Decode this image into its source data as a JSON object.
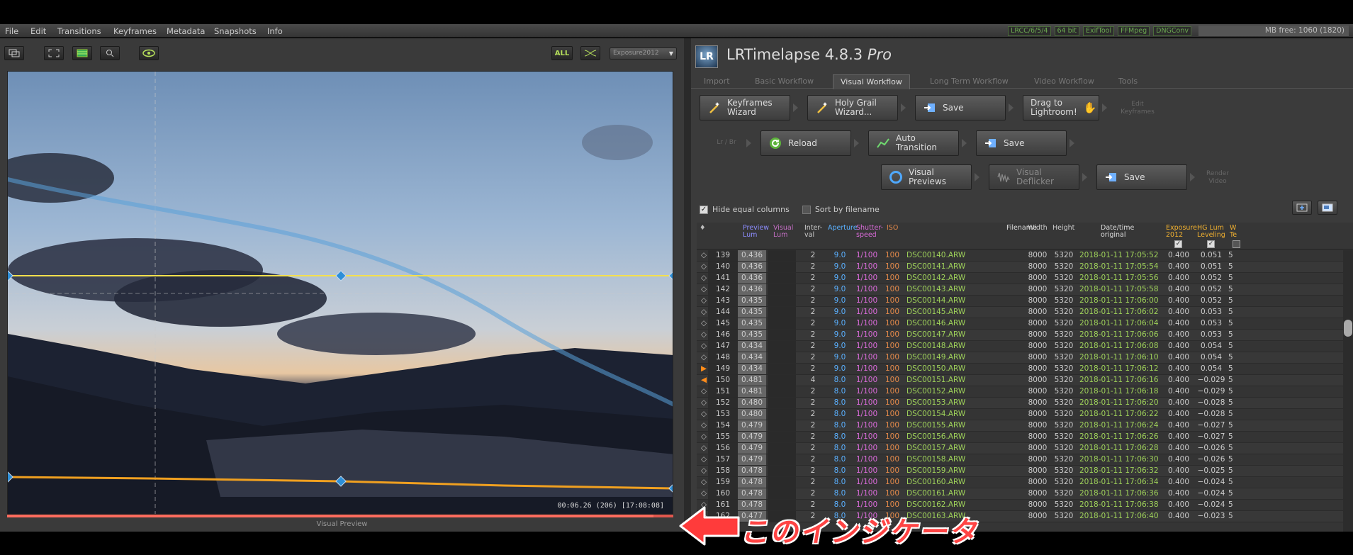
{
  "menu": [
    "File",
    "Edit",
    "Transitions",
    "Keyframes",
    "Metadata",
    "Snapshots",
    "Info"
  ],
  "badges": [
    "LRCC/6/5/4",
    "64 bit",
    "ExifTool",
    "FFMpeg",
    "DNGConv"
  ],
  "memory": "MB free: 1060 (1820)",
  "left": {
    "all_label": "ALL",
    "dropdown_value": "Exposure2012",
    "timecode": "00:06.26     (206)  [17:08:08]",
    "caption": "Visual Preview",
    "progress": 0.97
  },
  "app": {
    "title": "LRTimelapse 4.8.3",
    "title_suffix": "Pro",
    "logo": "LR"
  },
  "tabs": [
    "Import",
    "Basic Workflow",
    "Visual Workflow",
    "Long Term Workflow",
    "Video Workflow",
    "Tools"
  ],
  "active_tab": "Visual Workflow",
  "workflow": {
    "keyframes_wizard": "Keyframes\nWizard",
    "holy_grail_wizard": "Holy Grail\nWizard...",
    "save1": "Save",
    "drag_to_lightroom": "Drag to\nLightroom!",
    "edit_keyframes": "Edit\nKeyframes",
    "lr_br": "Lr / Br",
    "reload": "Reload",
    "auto_transition": "Auto\nTransition",
    "save2": "Save",
    "visual_previews": "Visual\nPreviews",
    "visual_deflicker": "Visual\nDeflicker",
    "save3": "Save",
    "render_video": "Render\nVideo"
  },
  "options": {
    "hide_equal_columns": "Hide equal columns",
    "sort_by_filename": "Sort by filename"
  },
  "table": {
    "headers": {
      "kf": "♦",
      "preview_lum": "Preview\nLum",
      "visual_lum": "Visual\nLum",
      "interval": "Inter-\nval",
      "aperture": "Aperture",
      "shutter": "Shutter-\nspeed",
      "iso": "ISO",
      "filename": "Filename",
      "width": "Width",
      "height": "Height",
      "datetime": "Date/time\noriginal",
      "exposure": "Exposure\n2012",
      "hglum": "HG Lum\nLeveling",
      "extra": "W\nTe"
    },
    "rows": [
      {
        "idx": "139",
        "pl": "0.436",
        "int": "2",
        "ap": "9.0",
        "sh": "1/100",
        "iso": "100",
        "fn": "DSC00140.ARW",
        "w": "8000",
        "h": "5320",
        "dt": "2018-01-11 17:05:52",
        "exp": "0.400",
        "hg": "0.051",
        "x": "5",
        "kf": ""
      },
      {
        "idx": "140",
        "pl": "0.436",
        "int": "2",
        "ap": "9.0",
        "sh": "1/100",
        "iso": "100",
        "fn": "DSC00141.ARW",
        "w": "8000",
        "h": "5320",
        "dt": "2018-01-11 17:05:54",
        "exp": "0.400",
        "hg": "0.051",
        "x": "5",
        "kf": ""
      },
      {
        "idx": "141",
        "pl": "0.436",
        "int": "2",
        "ap": "9.0",
        "sh": "1/100",
        "iso": "100",
        "fn": "DSC00142.ARW",
        "w": "8000",
        "h": "5320",
        "dt": "2018-01-11 17:05:56",
        "exp": "0.400",
        "hg": "0.052",
        "x": "5",
        "kf": ""
      },
      {
        "idx": "142",
        "pl": "0.436",
        "int": "2",
        "ap": "9.0",
        "sh": "1/100",
        "iso": "100",
        "fn": "DSC00143.ARW",
        "w": "8000",
        "h": "5320",
        "dt": "2018-01-11 17:05:58",
        "exp": "0.400",
        "hg": "0.052",
        "x": "5",
        "kf": ""
      },
      {
        "idx": "143",
        "pl": "0.435",
        "int": "2",
        "ap": "9.0",
        "sh": "1/100",
        "iso": "100",
        "fn": "DSC00144.ARW",
        "w": "8000",
        "h": "5320",
        "dt": "2018-01-11 17:06:00",
        "exp": "0.400",
        "hg": "0.052",
        "x": "5",
        "kf": ""
      },
      {
        "idx": "144",
        "pl": "0.435",
        "int": "2",
        "ap": "9.0",
        "sh": "1/100",
        "iso": "100",
        "fn": "DSC00145.ARW",
        "w": "8000",
        "h": "5320",
        "dt": "2018-01-11 17:06:02",
        "exp": "0.400",
        "hg": "0.053",
        "x": "5",
        "kf": ""
      },
      {
        "idx": "145",
        "pl": "0.435",
        "int": "2",
        "ap": "9.0",
        "sh": "1/100",
        "iso": "100",
        "fn": "DSC00146.ARW",
        "w": "8000",
        "h": "5320",
        "dt": "2018-01-11 17:06:04",
        "exp": "0.400",
        "hg": "0.053",
        "x": "5",
        "kf": ""
      },
      {
        "idx": "146",
        "pl": "0.435",
        "int": "2",
        "ap": "9.0",
        "sh": "1/100",
        "iso": "100",
        "fn": "DSC00147.ARW",
        "w": "8000",
        "h": "5320",
        "dt": "2018-01-11 17:06:06",
        "exp": "0.400",
        "hg": "0.053",
        "x": "5",
        "kf": ""
      },
      {
        "idx": "147",
        "pl": "0.434",
        "int": "2",
        "ap": "9.0",
        "sh": "1/100",
        "iso": "100",
        "fn": "DSC00148.ARW",
        "w": "8000",
        "h": "5320",
        "dt": "2018-01-11 17:06:08",
        "exp": "0.400",
        "hg": "0.054",
        "x": "5",
        "kf": ""
      },
      {
        "idx": "148",
        "pl": "0.434",
        "int": "2",
        "ap": "9.0",
        "sh": "1/100",
        "iso": "100",
        "fn": "DSC00149.ARW",
        "w": "8000",
        "h": "5320",
        "dt": "2018-01-11 17:06:10",
        "exp": "0.400",
        "hg": "0.054",
        "x": "5",
        "kf": ""
      },
      {
        "idx": "149",
        "pl": "0.434",
        "int": "2",
        "ap": "9.0",
        "sh": "1/100",
        "iso": "100",
        "fn": "DSC00150.ARW",
        "w": "8000",
        "h": "5320",
        "dt": "2018-01-11 17:06:12",
        "exp": "0.400",
        "hg": "0.054",
        "x": "5",
        "kf": "start"
      },
      {
        "idx": "150",
        "pl": "0.481",
        "int": "4",
        "ap": "8.0",
        "sh": "1/100",
        "iso": "100",
        "fn": "DSC00151.ARW",
        "w": "8000",
        "h": "5320",
        "dt": "2018-01-11 17:06:16",
        "exp": "0.400",
        "hg": "−0.029",
        "x": "5",
        "kf": "end"
      },
      {
        "idx": "151",
        "pl": "0.481",
        "int": "2",
        "ap": "8.0",
        "sh": "1/100",
        "iso": "100",
        "fn": "DSC00152.ARW",
        "w": "8000",
        "h": "5320",
        "dt": "2018-01-11 17:06:18",
        "exp": "0.400",
        "hg": "−0.029",
        "x": "5",
        "kf": ""
      },
      {
        "idx": "152",
        "pl": "0.480",
        "int": "2",
        "ap": "8.0",
        "sh": "1/100",
        "iso": "100",
        "fn": "DSC00153.ARW",
        "w": "8000",
        "h": "5320",
        "dt": "2018-01-11 17:06:20",
        "exp": "0.400",
        "hg": "−0.028",
        "x": "5",
        "kf": ""
      },
      {
        "idx": "153",
        "pl": "0.480",
        "int": "2",
        "ap": "8.0",
        "sh": "1/100",
        "iso": "100",
        "fn": "DSC00154.ARW",
        "w": "8000",
        "h": "5320",
        "dt": "2018-01-11 17:06:22",
        "exp": "0.400",
        "hg": "−0.028",
        "x": "5",
        "kf": ""
      },
      {
        "idx": "154",
        "pl": "0.479",
        "int": "2",
        "ap": "8.0",
        "sh": "1/100",
        "iso": "100",
        "fn": "DSC00155.ARW",
        "w": "8000",
        "h": "5320",
        "dt": "2018-01-11 17:06:24",
        "exp": "0.400",
        "hg": "−0.027",
        "x": "5",
        "kf": ""
      },
      {
        "idx": "155",
        "pl": "0.479",
        "int": "2",
        "ap": "8.0",
        "sh": "1/100",
        "iso": "100",
        "fn": "DSC00156.ARW",
        "w": "8000",
        "h": "5320",
        "dt": "2018-01-11 17:06:26",
        "exp": "0.400",
        "hg": "−0.027",
        "x": "5",
        "kf": ""
      },
      {
        "idx": "156",
        "pl": "0.479",
        "int": "2",
        "ap": "8.0",
        "sh": "1/100",
        "iso": "100",
        "fn": "DSC00157.ARW",
        "w": "8000",
        "h": "5320",
        "dt": "2018-01-11 17:06:28",
        "exp": "0.400",
        "hg": "−0.026",
        "x": "5",
        "kf": ""
      },
      {
        "idx": "157",
        "pl": "0.479",
        "int": "2",
        "ap": "8.0",
        "sh": "1/100",
        "iso": "100",
        "fn": "DSC00158.ARW",
        "w": "8000",
        "h": "5320",
        "dt": "2018-01-11 17:06:30",
        "exp": "0.400",
        "hg": "−0.026",
        "x": "5",
        "kf": ""
      },
      {
        "idx": "158",
        "pl": "0.478",
        "int": "2",
        "ap": "8.0",
        "sh": "1/100",
        "iso": "100",
        "fn": "DSC00159.ARW",
        "w": "8000",
        "h": "5320",
        "dt": "2018-01-11 17:06:32",
        "exp": "0.400",
        "hg": "−0.025",
        "x": "5",
        "kf": ""
      },
      {
        "idx": "159",
        "pl": "0.478",
        "int": "2",
        "ap": "8.0",
        "sh": "1/100",
        "iso": "100",
        "fn": "DSC00160.ARW",
        "w": "8000",
        "h": "5320",
        "dt": "2018-01-11 17:06:34",
        "exp": "0.400",
        "hg": "−0.024",
        "x": "5",
        "kf": ""
      },
      {
        "idx": "160",
        "pl": "0.478",
        "int": "2",
        "ap": "8.0",
        "sh": "1/100",
        "iso": "100",
        "fn": "DSC00161.ARW",
        "w": "8000",
        "h": "5320",
        "dt": "2018-01-11 17:06:36",
        "exp": "0.400",
        "hg": "−0.024",
        "x": "5",
        "kf": ""
      },
      {
        "idx": "161",
        "pl": "0.478",
        "int": "2",
        "ap": "8.0",
        "sh": "1/100",
        "iso": "100",
        "fn": "DSC00162.ARW",
        "w": "8000",
        "h": "5320",
        "dt": "2018-01-11 17:06:38",
        "exp": "0.400",
        "hg": "−0.024",
        "x": "5",
        "kf": ""
      },
      {
        "idx": "162",
        "pl": "0.477",
        "int": "2",
        "ap": "8.0",
        "sh": "1/100",
        "iso": "100",
        "fn": "DSC00163.ARW",
        "w": "8000",
        "h": "5320",
        "dt": "2018-01-11 17:06:40",
        "exp": "0.400",
        "hg": "−0.023",
        "x": "5",
        "kf": ""
      }
    ]
  },
  "annotation": "このインジケータ",
  "colors": {
    "yellow_curve": "#f4e04d",
    "orange_curve": "#f0a020",
    "blue_curve": "#5aa0d8",
    "annotation_red": "#ff3b3b"
  }
}
